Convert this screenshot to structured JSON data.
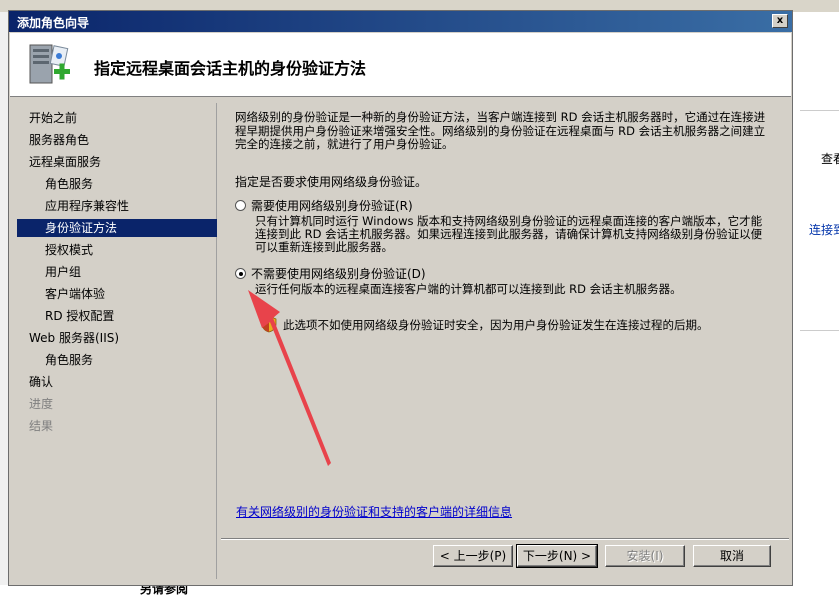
{
  "background": {
    "right_text_1": "查看",
    "right_link_2": "连接到",
    "bottom_text": "另请参阅"
  },
  "dialog": {
    "title": "添加角色向导",
    "close_label": "x",
    "header_title": "指定远程桌面会话主机的身份验证方法"
  },
  "nav": {
    "items": [
      {
        "label": "开始之前",
        "level": 0,
        "state": "normal"
      },
      {
        "label": "服务器角色",
        "level": 0,
        "state": "normal"
      },
      {
        "label": "远程桌面服务",
        "level": 0,
        "state": "normal"
      },
      {
        "label": "角色服务",
        "level": 1,
        "state": "normal"
      },
      {
        "label": "应用程序兼容性",
        "level": 1,
        "state": "normal"
      },
      {
        "label": "身份验证方法",
        "level": 1,
        "state": "selected"
      },
      {
        "label": "授权模式",
        "level": 1,
        "state": "normal"
      },
      {
        "label": "用户组",
        "level": 1,
        "state": "normal"
      },
      {
        "label": "客户端体验",
        "level": 1,
        "state": "normal"
      },
      {
        "label": "RD 授权配置",
        "level": 1,
        "state": "normal"
      },
      {
        "label": "Web 服务器(IIS)",
        "level": 0,
        "state": "normal"
      },
      {
        "label": "角色服务",
        "level": 1,
        "state": "normal"
      },
      {
        "label": "确认",
        "level": 0,
        "state": "normal"
      },
      {
        "label": "进度",
        "level": 0,
        "state": "disabled"
      },
      {
        "label": "结果",
        "level": 0,
        "state": "disabled"
      }
    ]
  },
  "content": {
    "intro": "网络级别的身份验证是一种新的身份验证方法，当客户端连接到 RD 会话主机服务器时，它通过在连接进程早期提供用户身份验证来增强安全性。网络级别的身份验证在远程桌面与 RD 会话主机服务器之间建立完全的连接之前，就进行了用户身份验证。",
    "prompt": "指定是否要求使用网络级身份验证。",
    "option_require": {
      "label": "需要使用网络级别身份验证(R)",
      "checked": false,
      "description": "只有计算机同时运行 Windows 版本和支持网络级别身份验证的远程桌面连接的客户端版本，它才能连接到此 RD 会话主机服务器。如果远程连接到此服务器，请确保计算机支持网络级别身份验证以便可以重新连接到此服务器。"
    },
    "option_no_require": {
      "label": "不需要使用网络级别身份验证(D)",
      "checked": true,
      "description": "运行任何版本的远程桌面连接客户端的计算机都可以连接到此 RD 会话主机服务器。",
      "warning": "此选项不如使用网络级身份验证时安全，因为用户身份验证发生在连接过程的后期。"
    },
    "info_link": "有关网络级别的身份验证和支持的客户端的详细信息"
  },
  "buttons": {
    "back": "< 上一步(P)",
    "next": "下一步(N) >",
    "install": "安装(I)",
    "cancel": "取消"
  },
  "colors": {
    "selected_nav": "#0a246a",
    "arrow": "#e8434b"
  }
}
